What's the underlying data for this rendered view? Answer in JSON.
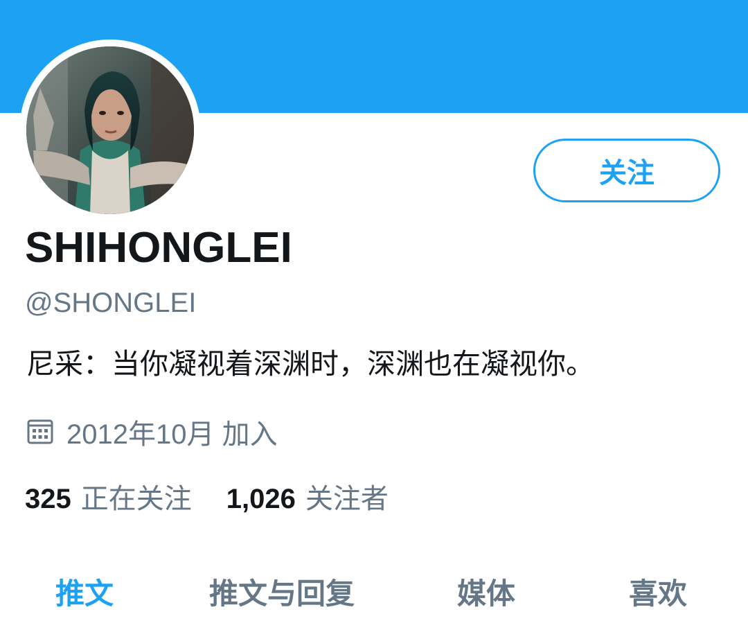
{
  "profile": {
    "display_name": "SHIHONGLEI",
    "handle": "@SHONGLEI",
    "bio": "尼采：当你凝视着深渊时，深渊也在凝视你。",
    "joined": "2012年10月 加入"
  },
  "actions": {
    "follow_label": "关注"
  },
  "stats": {
    "following_count": "325",
    "following_label": "正在关注",
    "followers_count": "1,026",
    "followers_label": "关注者"
  },
  "tabs": [
    {
      "label": "推文",
      "active": true
    },
    {
      "label": "推文与回复",
      "active": false
    },
    {
      "label": "媒体",
      "active": false
    },
    {
      "label": "喜欢",
      "active": false
    }
  ],
  "icons": {
    "joined": "calendar-icon"
  },
  "colors": {
    "accent": "#1da1f2",
    "text_primary": "#14171a",
    "text_secondary": "#657786",
    "background": "#ffffff"
  }
}
